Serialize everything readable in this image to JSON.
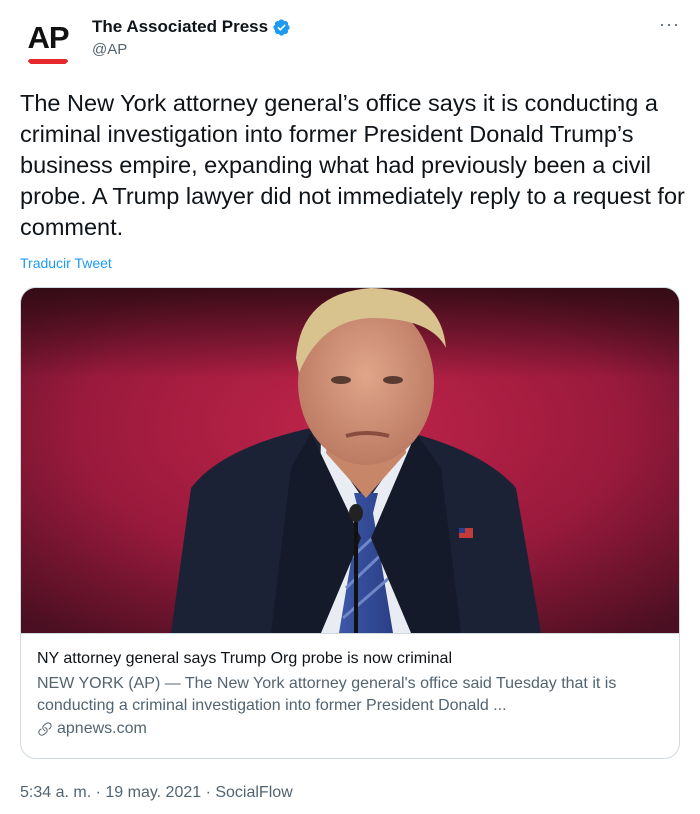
{
  "author": {
    "display_name": "The Associated Press",
    "handle": "@AP",
    "avatar_text": "AP",
    "verified": true,
    "more_label": "···"
  },
  "tweet": {
    "text": "The New York attorney general’s office says it is conducting a criminal investigation into former President Donald Trump’s business empire, expanding what had previously been a civil probe. A Trump lawyer did not immediately reply to a request for comment.",
    "translate_label": "Traducir Tweet"
  },
  "card": {
    "title": "NY attorney general says Trump Org probe is now criminal",
    "description": "NEW YORK (AP) — The New York attorney general's office said Tuesday that it is conducting a criminal investigation into former President Donald ...",
    "link": "apnews.com"
  },
  "meta": {
    "timestamp": "5:34 a. m. · 19 may. 2021 · SocialFlow"
  },
  "colors": {
    "accent": "#1d9bf0",
    "text": "#0f1419",
    "secondary": "#536471",
    "border": "#cfd9de",
    "ap_red": "#e6282b"
  }
}
